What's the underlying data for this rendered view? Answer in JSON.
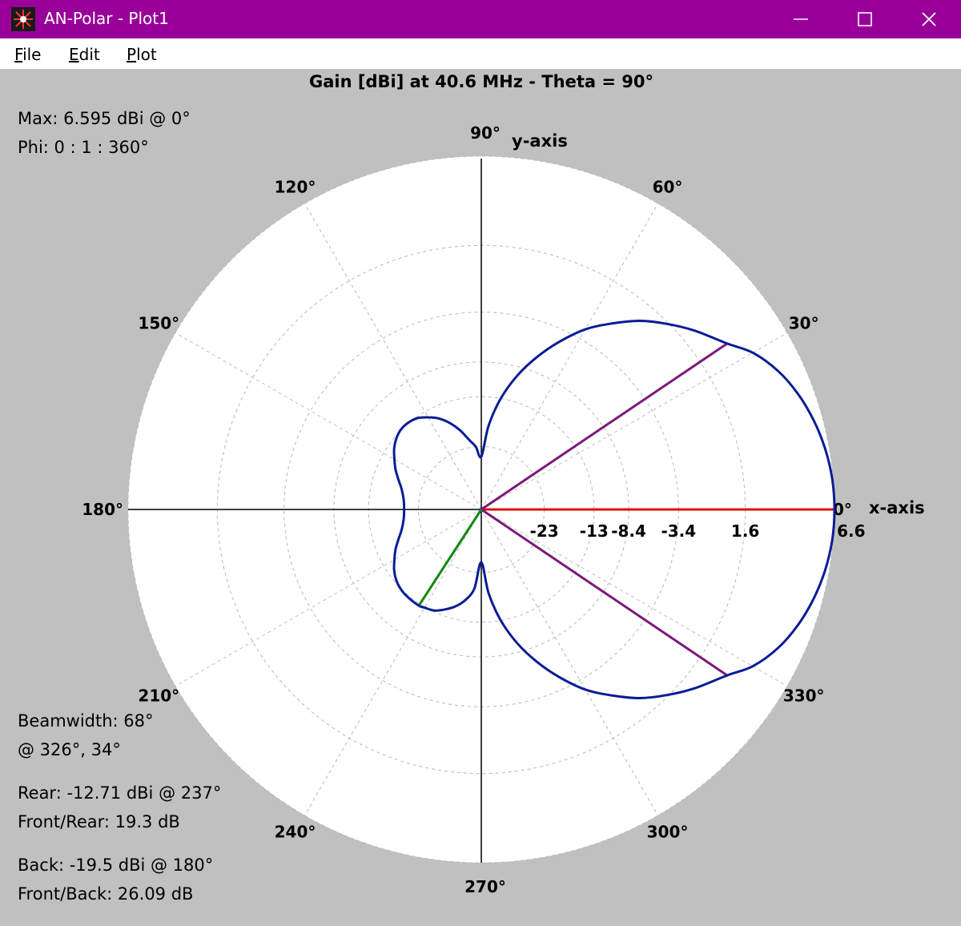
{
  "window": {
    "title": "AN-Polar - Plot1",
    "accent_color": "#990099",
    "controls": [
      "minimize-icon",
      "maximize-icon",
      "close-icon"
    ]
  },
  "menu": [
    {
      "underline": "F",
      "rest": "ile"
    },
    {
      "underline": "E",
      "rest": "dit"
    },
    {
      "underline": "P",
      "rest": "lot"
    }
  ],
  "stats": {
    "max": "Max: 6.595 dBi @ 0°",
    "phi": "Phi: 0 : 1 : 360°",
    "beamwidth": "Beamwidth: 68°",
    "beamwidth_at": "@ 326°, 34°",
    "rear": "Rear: -12.71 dBi @ 237°",
    "front_rear": "Front/Rear: 19.3 dB",
    "back": "Back: -19.5 dBi @ 180°",
    "front_back": "Front/Back: 26.09 dB"
  },
  "chart_data": {
    "type": "polar",
    "title": "Gain [dBi] at 40.6 MHz - Theta = 90°",
    "angle_unit": "deg",
    "angle_labels": [
      {
        "deg": 0,
        "text": "0°"
      },
      {
        "deg": 30,
        "text": "30°"
      },
      {
        "deg": 60,
        "text": "60°"
      },
      {
        "deg": 90,
        "text": "90°"
      },
      {
        "deg": 120,
        "text": "120°"
      },
      {
        "deg": 150,
        "text": "150°"
      },
      {
        "deg": 180,
        "text": "180°"
      },
      {
        "deg": 210,
        "text": "210°"
      },
      {
        "deg": 240,
        "text": "240°"
      },
      {
        "deg": 270,
        "text": "270°"
      },
      {
        "deg": 300,
        "text": "300°"
      },
      {
        "deg": 330,
        "text": "330°"
      }
    ],
    "axis_labels": {
      "x": "x-axis",
      "y": "y-axis"
    },
    "radial_tick_labels": [
      "-23",
      "-13",
      "-8.4",
      "-3.4",
      "1.6",
      "6.6"
    ],
    "radial_scale": "arrl-log",
    "max_dbi": 6.595,
    "grid": true,
    "pattern": {
      "color": "#0a1c96",
      "points": [
        [
          0,
          6.595
        ],
        [
          5,
          6.55
        ],
        [
          10,
          6.4
        ],
        [
          15,
          6.15
        ],
        [
          20,
          5.8
        ],
        [
          25,
          5.3
        ],
        [
          30,
          4.55
        ],
        [
          34,
          3.6
        ],
        [
          40,
          2.5
        ],
        [
          45,
          1.5
        ],
        [
          50,
          0.4
        ],
        [
          55,
          -1.0
        ],
        [
          60,
          -2.5
        ],
        [
          65,
          -4.5
        ],
        [
          70,
          -6.8
        ],
        [
          75,
          -9.5
        ],
        [
          80,
          -13.0
        ],
        [
          85,
          -18.0
        ],
        [
          90,
          -26.0
        ],
        [
          95,
          -23.0
        ],
        [
          100,
          -21.0
        ],
        [
          105,
          -18.5
        ],
        [
          110,
          -16.5
        ],
        [
          115,
          -15.0
        ],
        [
          120,
          -14.0
        ],
        [
          125,
          -13.2
        ],
        [
          130,
          -12.9
        ],
        [
          135,
          -12.9
        ],
        [
          140,
          -13.3
        ],
        [
          145,
          -14.0
        ],
        [
          150,
          -15.0
        ],
        [
          155,
          -16.0
        ],
        [
          160,
          -17.2
        ],
        [
          165,
          -18.3
        ],
        [
          170,
          -19.0
        ],
        [
          175,
          -19.4
        ],
        [
          180,
          -19.5
        ],
        [
          185,
          -19.4
        ],
        [
          190,
          -19.0
        ],
        [
          195,
          -18.3
        ],
        [
          200,
          -17.2
        ],
        [
          205,
          -16.0
        ],
        [
          210,
          -15.0
        ],
        [
          215,
          -14.0
        ],
        [
          220,
          -13.3
        ],
        [
          225,
          -12.9
        ],
        [
          230,
          -12.75
        ],
        [
          237,
          -12.71
        ],
        [
          240,
          -12.9
        ],
        [
          245,
          -13.2
        ],
        [
          250,
          -14.0
        ],
        [
          255,
          -15.0
        ],
        [
          260,
          -16.5
        ],
        [
          265,
          -19.0
        ],
        [
          270,
          -26.0
        ],
        [
          275,
          -18.0
        ],
        [
          280,
          -13.0
        ],
        [
          285,
          -9.5
        ],
        [
          290,
          -6.8
        ],
        [
          295,
          -4.5
        ],
        [
          300,
          -2.5
        ],
        [
          305,
          -1.0
        ],
        [
          310,
          0.4
        ],
        [
          315,
          1.5
        ],
        [
          320,
          2.5
        ],
        [
          326,
          3.6
        ],
        [
          330,
          4.55
        ],
        [
          335,
          5.3
        ],
        [
          340,
          5.8
        ],
        [
          345,
          6.15
        ],
        [
          350,
          6.4
        ],
        [
          355,
          6.55
        ]
      ]
    },
    "markers": [
      {
        "name": "max",
        "deg": 0,
        "value": 6.595,
        "color": "#dd1111"
      },
      {
        "name": "beamwidth-34",
        "deg": 34,
        "value": 3.6,
        "color": "#7a1a7a"
      },
      {
        "name": "beamwidth-326",
        "deg": 326,
        "value": 3.6,
        "color": "#7a1a7a"
      },
      {
        "name": "rear",
        "deg": 237,
        "value": -12.71,
        "color": "#118811"
      }
    ]
  }
}
